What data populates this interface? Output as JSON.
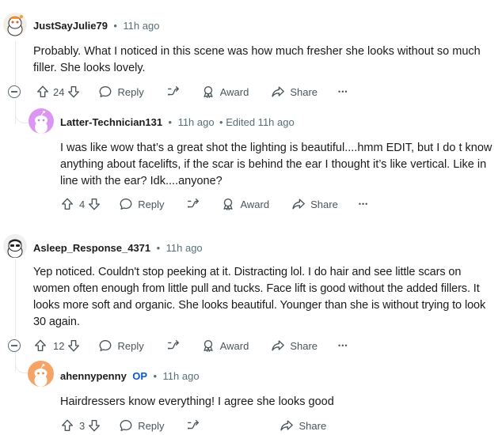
{
  "comments": [
    {
      "username": "JustSayJulie79",
      "dot": "•",
      "time": "11h ago",
      "body": "Probably. What I noticed in this scene was how much fresher she looks without so much filler. She looks lovely.",
      "votes": "24",
      "reply": "Reply",
      "award": "Award",
      "share": "Share",
      "more": "•••"
    },
    {
      "username": "Latter-Technician131",
      "dot": "•",
      "time": "11h ago",
      "edited": "• Edited 11h ago",
      "body": "I was like wow that’s a great shot the lighting is beautiful....hmm EDIT, but I do t know anything about facelifts, if the scar is behind the ear I thought it’s like vertical. Like in line with the ear? Idk....anyone?",
      "votes": "4",
      "reply": "Reply",
      "award": "Award",
      "share": "Share",
      "more": "•••"
    },
    {
      "username": "Asleep_Response_4371",
      "dot": "•",
      "time": "11h ago",
      "body": "Yep noticed. Couldn't stop peeking at it. Distracting lol. I do hair and see little scars on women often enough from little pull and tucks. Face lift is good without the added fillers. It looks more soft and organic. She looks beautiful. Younger than she is without trying to look 30 again.",
      "votes": "12",
      "reply": "Reply",
      "award": "Award",
      "share": "Share",
      "more": "•••"
    },
    {
      "username": "ahennypenny",
      "op": "OP",
      "dot": "•",
      "time": "11h ago",
      "body": "Hairdressers know everything! I agree she looks good",
      "votes": "3",
      "reply": "Reply",
      "share": "Share"
    }
  ],
  "icons": {
    "upvote": "upvote-icon",
    "downvote": "downvote-icon",
    "reply": "reply-bubble-icon",
    "swap": "branch-icon",
    "award": "award-ribbon-icon",
    "share": "share-arrow-icon",
    "collapse": "collapse-minus-icon"
  },
  "colors": {
    "op_blue": "#0a58ca",
    "meta_gray": "#576f76",
    "thread_line": "#e5ebee"
  }
}
